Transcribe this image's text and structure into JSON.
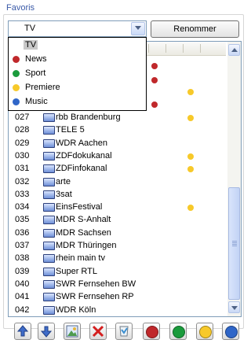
{
  "group": {
    "title": "Favoris"
  },
  "combo": {
    "value": "TV",
    "button_icon": "chevron-down-icon"
  },
  "rename_button": {
    "label": "Renommer"
  },
  "dropdown": {
    "items": [
      {
        "label": "TV",
        "color": "",
        "selected": true
      },
      {
        "label": "News",
        "color": "#c0282b"
      },
      {
        "label": "Sport",
        "color": "#1a9b3c"
      },
      {
        "label": "Premiere",
        "color": "#f7c92a"
      },
      {
        "label": "Music",
        "color": "#2f66c8"
      }
    ]
  },
  "colors": {
    "red": "#c0282b",
    "green": "#1a9b3c",
    "yellow": "#f7c92a",
    "blue": "#2f66c8"
  },
  "channels": [
    {
      "num": "027",
      "name": "rbb Brandenburg",
      "marks": [
        "yellow"
      ]
    },
    {
      "num": "028",
      "name": "TELE 5",
      "marks": []
    },
    {
      "num": "029",
      "name": "WDR Aachen",
      "marks": []
    },
    {
      "num": "030",
      "name": "ZDFdokukanal",
      "marks": [
        "yellow"
      ]
    },
    {
      "num": "031",
      "name": "ZDFinfokanal",
      "marks": [
        "yellow"
      ]
    },
    {
      "num": "032",
      "name": "arte",
      "marks": []
    },
    {
      "num": "033",
      "name": "3sat",
      "marks": []
    },
    {
      "num": "034",
      "name": "EinsFestival",
      "marks": [
        "yellow"
      ]
    },
    {
      "num": "035",
      "name": "MDR S-Anhalt",
      "marks": []
    },
    {
      "num": "036",
      "name": "MDR Sachsen",
      "marks": []
    },
    {
      "num": "037",
      "name": "MDR Thüringen",
      "marks": []
    },
    {
      "num": "038",
      "name": "rhein main tv",
      "marks": []
    },
    {
      "num": "039",
      "name": "Super RTL",
      "marks": []
    },
    {
      "num": "040",
      "name": "SWR Fernsehen BW",
      "marks": []
    },
    {
      "num": "041",
      "name": "SWR Fernsehen RP",
      "marks": []
    },
    {
      "num": "042",
      "name": "WDR Köln",
      "marks": []
    }
  ],
  "hidden_rows_marks": [
    [
      "red"
    ],
    [
      "red"
    ],
    [
      "yellow"
    ],
    [
      "red"
    ]
  ],
  "toolbar": [
    {
      "name": "move-up-button",
      "icon": "arrow-up-icon"
    },
    {
      "name": "move-down-button",
      "icon": "arrow-down-icon"
    },
    {
      "name": "picture-button",
      "icon": "picture-icon"
    },
    {
      "name": "delete-button",
      "icon": "delete-x-icon"
    },
    {
      "name": "filter-button",
      "icon": "filter-icon"
    },
    {
      "name": "red-favorite-button",
      "icon": "red-circle-icon",
      "color": "#c0282b"
    },
    {
      "name": "green-favorite-button",
      "icon": "green-circle-icon",
      "color": "#1a9b3c"
    },
    {
      "name": "yellow-favorite-button",
      "icon": "yellow-circle-icon",
      "color": "#f7c92a"
    },
    {
      "name": "blue-favorite-button",
      "icon": "blue-circle-icon",
      "color": "#2f66c8"
    }
  ]
}
